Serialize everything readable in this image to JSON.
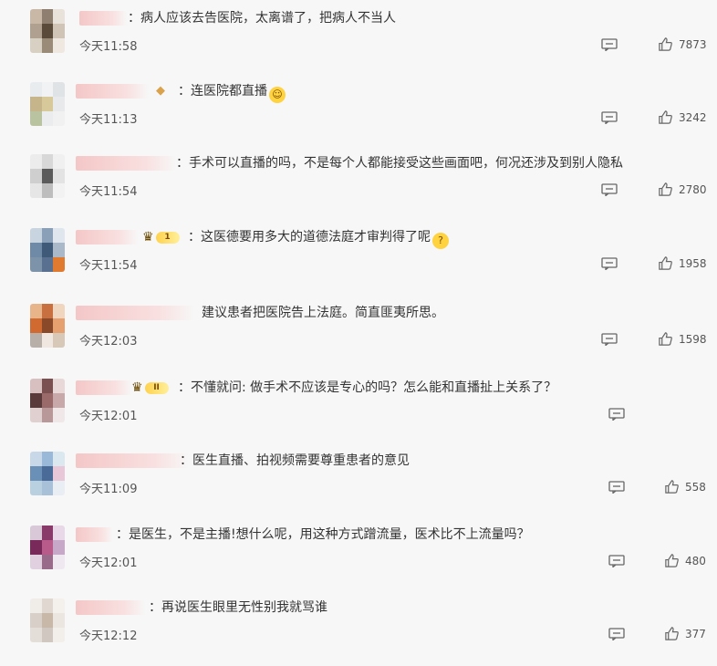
{
  "comments": [
    {
      "text": "：病人应该去告医院，太离谱了，把病人不当人",
      "time": "今天11:58",
      "likes": "7873"
    },
    {
      "text": "：连医院都直播",
      "time": "今天11:13",
      "likes": "3242"
    },
    {
      "text": "：手术可以直播的吗，不是每个人都能接受这些画面吧，何况还涉及到别人隐私",
      "time": "今天11:54",
      "likes": "2780"
    },
    {
      "text": "：这医德要用多大的道德法庭才审判得了呢",
      "time": "今天11:54",
      "likes": "1958"
    },
    {
      "text": "建议患者把医院告上法庭。简直匪夷所思。",
      "time": "今天12:03",
      "likes": "1598"
    },
    {
      "text": "：不懂就问: 做手术不应该是专心的吗？怎么能和直播扯上关系了？",
      "time": "今天12:01",
      "likes": ""
    },
    {
      "text": "：医生直播、拍视频需要尊重患者的意见",
      "time": "今天11:09",
      "likes": "558"
    },
    {
      "text": "：是医生，不是主播!想什么呢，用这种方式蹭流量，医术比不上流量吗？",
      "time": "今天12:01",
      "likes": "480"
    },
    {
      "text": "：再说医生眼里无性别我就骂谁",
      "time": "今天12:12",
      "likes": "377"
    }
  ],
  "badges": {
    "level_a": "1",
    "level_b": "II"
  },
  "colors": {
    "bg": "#f7f7f7",
    "text": "#333333",
    "meta": "#555555"
  }
}
